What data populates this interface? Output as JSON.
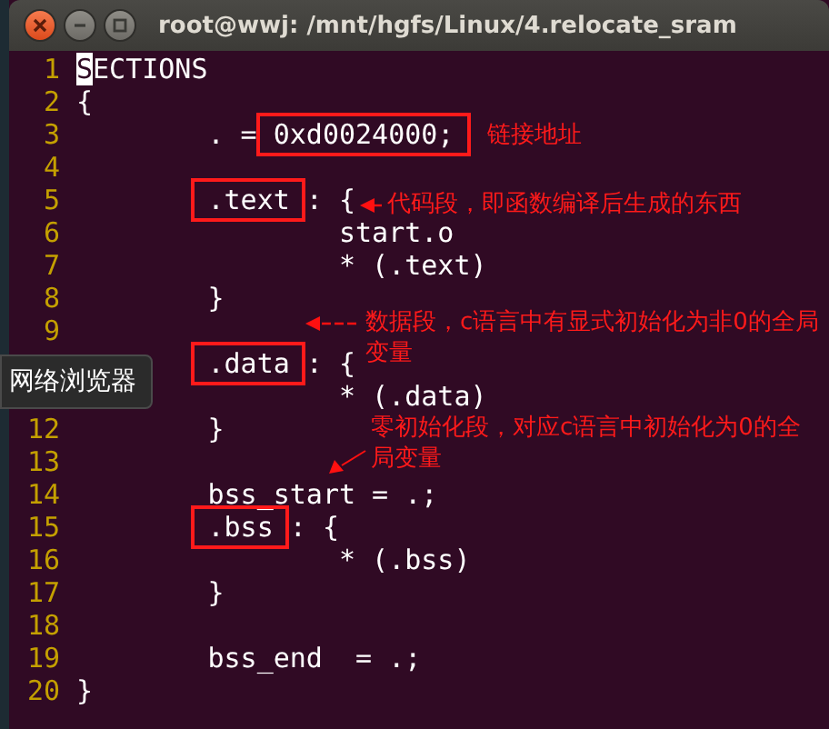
{
  "window": {
    "title": "root@wwj: /mnt/hgfs/Linux/4.relocate_sram"
  },
  "lines": [
    {
      "number": "1",
      "segments": [
        {
          "kind": "cursor",
          "text": "S"
        },
        {
          "kind": "plain",
          "text": "ECTIONS"
        }
      ]
    },
    {
      "number": "2",
      "segments": [
        {
          "kind": "plain",
          "text": "{"
        }
      ]
    },
    {
      "number": "3",
      "segments": [
        {
          "kind": "plain",
          "text": "        . = "
        },
        {
          "kind": "boxed",
          "text": "0xd0024000;"
        }
      ]
    },
    {
      "number": "4"
    },
    {
      "number": "5",
      "indented": true,
      "segments": [
        {
          "kind": "boxed",
          "text": ".text"
        },
        {
          "kind": "plain",
          "text": " : {"
        }
      ]
    },
    {
      "number": "6",
      "segments": [
        {
          "kind": "plain",
          "text": "                start.o"
        }
      ]
    },
    {
      "number": "7",
      "segments": [
        {
          "kind": "plain",
          "text": "                * (.text)"
        }
      ]
    },
    {
      "number": "8",
      "segments": [
        {
          "kind": "plain",
          "text": "        }"
        }
      ]
    },
    {
      "number": "9"
    },
    {
      "indented": true,
      "segments": [
        {
          "kind": "boxed",
          "text": ".data"
        },
        {
          "kind": "plain",
          "text": " : {"
        }
      ]
    },
    {
      "segments": [
        {
          "kind": "plain",
          "text": "                * (.data)"
        }
      ]
    },
    {
      "number": "12",
      "segments": [
        {
          "kind": "plain",
          "text": "        }"
        }
      ]
    },
    {
      "number": "13"
    },
    {
      "number": "14",
      "segments": [
        {
          "kind": "plain",
          "text": "        bss_start = .;"
        }
      ]
    },
    {
      "number": "15",
      "indented": true,
      "segments": [
        {
          "kind": "boxed",
          "text": ".bss"
        },
        {
          "kind": "plain",
          "text": " : {"
        }
      ]
    },
    {
      "number": "16",
      "segments": [
        {
          "kind": "plain",
          "text": "                * (.bss)"
        }
      ]
    },
    {
      "number": "17",
      "segments": [
        {
          "kind": "plain",
          "text": "        }"
        }
      ]
    },
    {
      "number": "18"
    },
    {
      "number": "19",
      "segments": [
        {
          "kind": "plain",
          "text": "        bss_end  = .;"
        }
      ]
    },
    {
      "number": "20",
      "segments": [
        {
          "kind": "plain",
          "text": "}"
        }
      ]
    }
  ],
  "annotations": [
    {
      "kind": "none",
      "text": "链接地址"
    },
    {
      "kind": "left",
      "text": "代码段，即函数编译后生成的东西"
    },
    {
      "kind": "left",
      "text": "数据段，c语言中有显式初始化为非0的全局变量"
    },
    {
      "kind": "down",
      "text": "零初始化段，对应c语言中初始化为0的全局变量"
    }
  ],
  "tooltip": {
    "text": "网络浏览器"
  }
}
